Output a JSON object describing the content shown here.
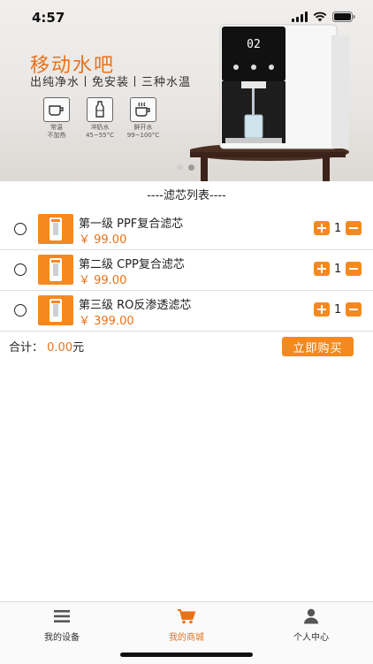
{
  "status_bar": {
    "time": "4:57"
  },
  "banner": {
    "title": "移动水吧",
    "subtitle": "出纯净水丨免安装丨三种水温",
    "features": [
      {
        "icon": "cup-icon",
        "name": "常温",
        "note": "不加热"
      },
      {
        "icon": "bottle-icon",
        "name": "冲奶水",
        "note": "45~55°C"
      },
      {
        "icon": "hot-cup-icon",
        "name": "鲜开水",
        "note": "99~100°C"
      }
    ],
    "machine_display": "02",
    "carousel_active": 2
  },
  "list": {
    "header": "----滤芯列表----",
    "items": [
      {
        "name": "第一级 PPF复合滤芯",
        "price": "￥ 99.00",
        "qty": "1"
      },
      {
        "name": "第二级 CPP复合滤芯",
        "price": "￥ 99.00",
        "qty": "1"
      },
      {
        "name": "第三级 RO反渗透滤芯",
        "price": "￥ 399.00",
        "qty": "1"
      }
    ]
  },
  "total": {
    "label": "合计：",
    "value": "0.00",
    "unit": "元"
  },
  "buy_button": {
    "label": "立即购买"
  },
  "tabbar": {
    "tabs": [
      {
        "label": "我的设备",
        "icon": "menu-icon",
        "active": false
      },
      {
        "label": "我的商城",
        "icon": "cart-icon",
        "active": true
      },
      {
        "label": "个人中心",
        "icon": "person-icon",
        "active": false
      }
    ]
  },
  "colors": {
    "accent": "#f5891f",
    "price": "#e8721c",
    "text": "#222222"
  }
}
